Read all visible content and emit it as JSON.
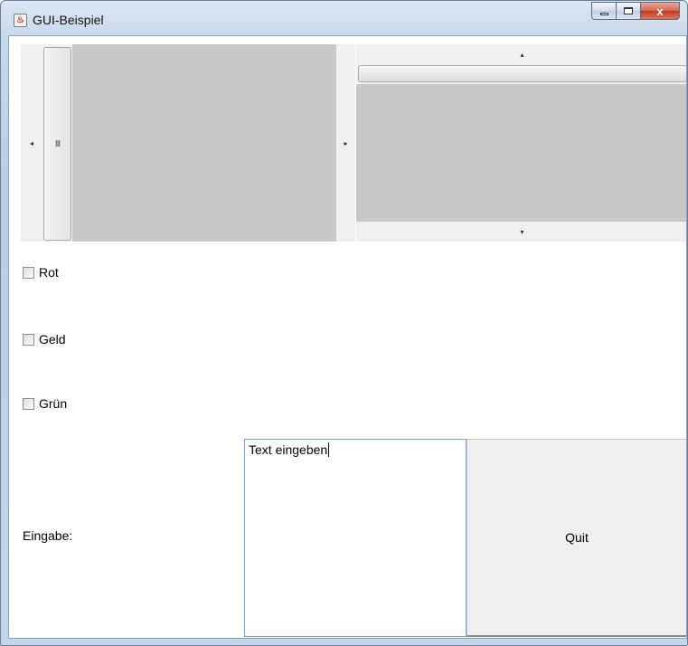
{
  "window": {
    "title": "GUI-Beispiel",
    "close_glyph": "x"
  },
  "scrollbars": {
    "horizontal": {
      "left_arrow": "◂",
      "right_arrow": "▸",
      "thumb_grip": "III"
    },
    "vertical": {
      "up_arrow": "▴",
      "down_arrow": "▾"
    }
  },
  "checkboxes": [
    {
      "label": "Rot",
      "checked": false
    },
    {
      "label": "Geld",
      "checked": false
    },
    {
      "label": "Grün",
      "checked": false
    }
  ],
  "form": {
    "input_label": "Eingabe:",
    "input_value": "Text eingeben",
    "quit_label": "Quit"
  }
}
